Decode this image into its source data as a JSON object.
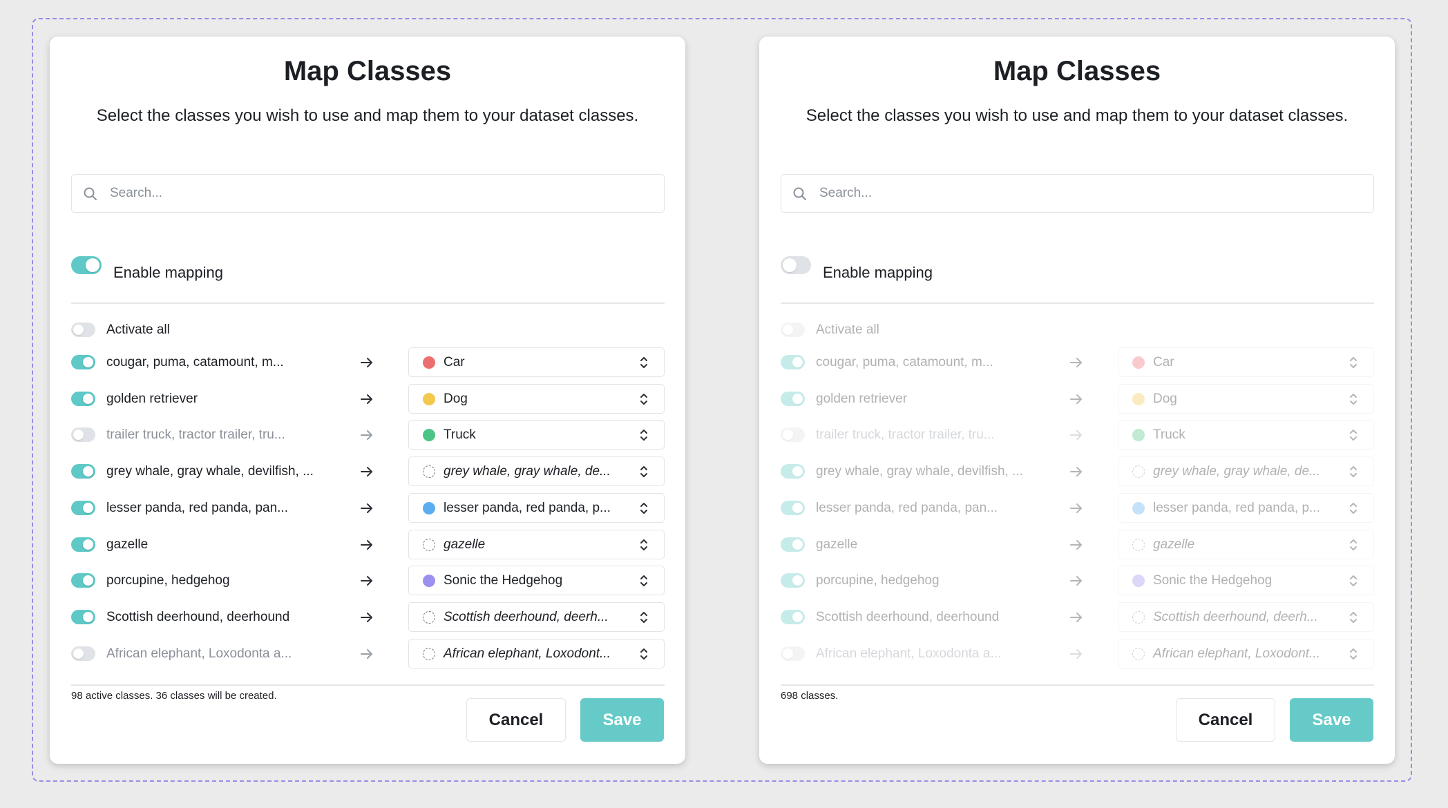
{
  "colors": {
    "accent": "#5ec9c6",
    "save_button": "#66cbc8",
    "toggle_off": "#dfe2e6",
    "frame_border": "#9a8ce6"
  },
  "icons": {
    "search": "search-icon",
    "arrow": "arrow-right-icon",
    "select": "chevron-updown-icon"
  },
  "left": {
    "title": "Map Classes",
    "subtitle": "Select the classes you wish to use and map them to your dataset classes.",
    "search_placeholder": "Search...",
    "enable_mapping": {
      "label": "Enable mapping",
      "on": true
    },
    "activate_all": {
      "label": "Activate all",
      "on": false
    },
    "rows": [
      {
        "label": "cougar, puma, catamount, m...",
        "active": true,
        "target": "Car",
        "dot": "#ec6f6f",
        "italic": false
      },
      {
        "label": "golden retriever",
        "active": true,
        "target": "Dog",
        "dot": "#f2c94c",
        "italic": false
      },
      {
        "label": "trailer truck, tractor trailer, tru...",
        "active": false,
        "target": "Truck",
        "dot": "#4cc486",
        "italic": false
      },
      {
        "label": "grey whale, gray whale, devilfish, ...",
        "active": true,
        "target": "grey whale, gray whale, de...",
        "dot": "",
        "italic": true
      },
      {
        "label": "lesser panda, red panda, pan...",
        "active": true,
        "target": "lesser panda, red panda, p...",
        "dot": "#5aaef0",
        "italic": false
      },
      {
        "label": "gazelle",
        "active": true,
        "target": "gazelle",
        "dot": "",
        "italic": true
      },
      {
        "label": "porcupine, hedgehog",
        "active": true,
        "target": "Sonic the Hedgehog",
        "dot": "#9b8ff0",
        "italic": false
      },
      {
        "label": "Scottish deerhound, deerhound",
        "active": true,
        "target": "Scottish deerhound, deerh...",
        "dot": "",
        "italic": true
      },
      {
        "label": "African elephant, Loxodonta a...",
        "active": false,
        "target": "African elephant, Loxodont...",
        "dot": "",
        "italic": true
      }
    ],
    "footer": "98 active classes. 36 classes will be created.",
    "cancel_label": "Cancel",
    "save_label": "Save"
  },
  "right": {
    "title": "Map Classes",
    "subtitle": "Select the classes you wish to use and map them to your dataset classes.",
    "search_placeholder": "Search...",
    "enable_mapping": {
      "label": "Enable mapping",
      "on": false
    },
    "activate_all": {
      "label": "Activate all",
      "on": false
    },
    "rows": [
      {
        "label": "cougar, puma, catamount, m...",
        "active": true,
        "target": "Car",
        "dot": "#ec6f6f",
        "italic": false
      },
      {
        "label": "golden retriever",
        "active": true,
        "target": "Dog",
        "dot": "#f2c94c",
        "italic": false
      },
      {
        "label": "trailer truck, tractor trailer, tru...",
        "active": false,
        "target": "Truck",
        "dot": "#4cc486",
        "italic": false
      },
      {
        "label": "grey whale, gray whale, devilfish, ...",
        "active": true,
        "target": "grey whale, gray whale, de...",
        "dot": "",
        "italic": true
      },
      {
        "label": "lesser panda, red panda, pan...",
        "active": true,
        "target": "lesser panda, red panda, p...",
        "dot": "#5aaef0",
        "italic": false
      },
      {
        "label": "gazelle",
        "active": true,
        "target": "gazelle",
        "dot": "",
        "italic": true
      },
      {
        "label": "porcupine, hedgehog",
        "active": true,
        "target": "Sonic the Hedgehog",
        "dot": "#9b8ff0",
        "italic": false
      },
      {
        "label": "Scottish deerhound, deerhound",
        "active": true,
        "target": "Scottish deerhound, deerh...",
        "dot": "",
        "italic": true
      },
      {
        "label": "African elephant, Loxodonta a...",
        "active": false,
        "target": "African elephant, Loxodont...",
        "dot": "",
        "italic": true
      }
    ],
    "footer": "698 classes.",
    "cancel_label": "Cancel",
    "save_label": "Save"
  }
}
